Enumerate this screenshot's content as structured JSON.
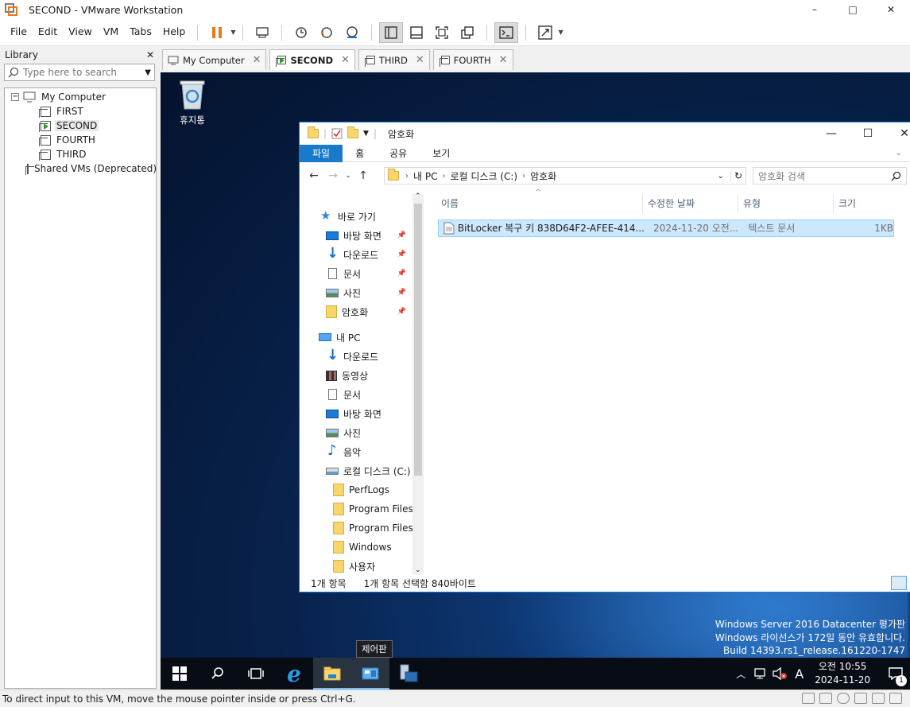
{
  "window": {
    "title": "SECOND - VMware Workstation",
    "minimize": "–",
    "maximize": "□",
    "close": "✕"
  },
  "menu": [
    "File",
    "Edit",
    "View",
    "VM",
    "Tabs",
    "Help"
  ],
  "library": {
    "title": "Library",
    "close": "✕",
    "search_placeholder": "Type here to search",
    "tree": {
      "root": "My Computer",
      "vms": [
        "FIRST",
        "SECOND",
        "FOURTH",
        "THIRD"
      ],
      "shared": "Shared VMs (Deprecated)"
    }
  },
  "tabs": [
    {
      "label": "My Computer"
    },
    {
      "label": "SECOND"
    },
    {
      "label": "THIRD"
    },
    {
      "label": "FOURTH"
    }
  ],
  "desktop": {
    "recycle_bin": "휴지통"
  },
  "explorer": {
    "title": "암호화",
    "ribbon": [
      "파일",
      "홈",
      "공유",
      "보기"
    ],
    "address": [
      "내 PC",
      "로컬 디스크 (C:)",
      "암호화"
    ],
    "search_placeholder": "암호화 검색",
    "nav": {
      "quick_access": "바로 가기",
      "quick_items": [
        "바탕 화면",
        "다운로드",
        "문서",
        "사진",
        "암호화"
      ],
      "this_pc": "내 PC",
      "pc_items": [
        "다운로드",
        "동영상",
        "문서",
        "바탕 화면",
        "사진",
        "음악",
        "로컬 디스크 (C:)"
      ],
      "drive_items": [
        "PerfLogs",
        "Program Files",
        "Program Files",
        "Windows",
        "사용자"
      ]
    },
    "columns": [
      "이름",
      "수정한 날짜",
      "유형",
      "크기"
    ],
    "file": {
      "name": "BitLocker 복구 키 838D64F2-AFEE-414...",
      "modified": "2024-11-20 오전...",
      "type": "텍스트 문서",
      "size": "1KB"
    },
    "status": {
      "count": "1개 항목",
      "selected": "1개 항목 선택함 840바이트"
    }
  },
  "taskbar": {
    "tooltip": "제어판",
    "watermark": [
      "Windows Server 2016 Datacenter 평가판",
      "Windows 라이선스가 172일 동안 유효합니다.",
      "Build 14393.rs1_release.161220-1747"
    ],
    "ime": "A",
    "time": "오전 10:55",
    "date": "2024-11-20",
    "notification_count": "1"
  },
  "statusbar": {
    "message": "To direct input to this VM, move the mouse pointer inside or press Ctrl+G."
  },
  "colors": {
    "accent": "#1979ca",
    "pause": "#e8791d",
    "selection": "#cce8ff"
  }
}
